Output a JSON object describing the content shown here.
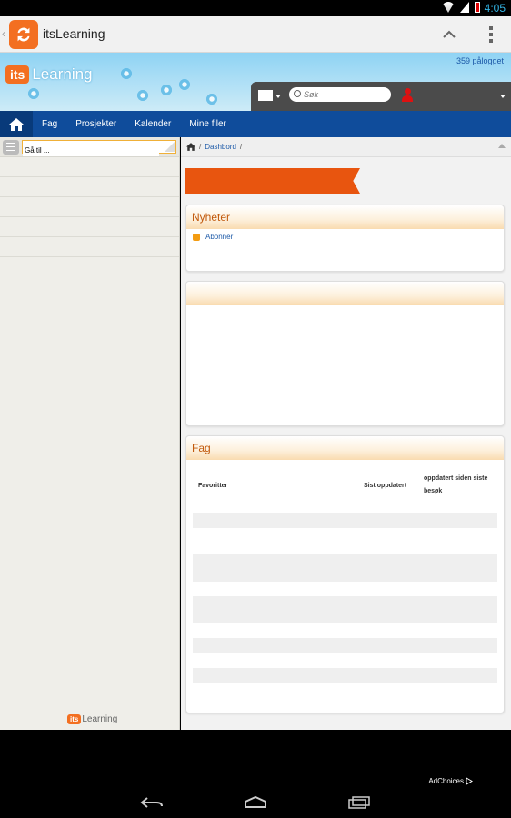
{
  "status_bar": {
    "time": "4:05"
  },
  "action_bar": {
    "title": "itsLearning"
  },
  "banner": {
    "logo_its": "its",
    "logo_learning": "Learning",
    "online_count": "359 pålogget"
  },
  "user_bar": {
    "search_placeholder": "Søk"
  },
  "nav": {
    "items": [
      "Fag",
      "Prosjekter",
      "Kalender",
      "Mine filer"
    ]
  },
  "sidebar": {
    "goto_value": "Gå til ...",
    "footer_its": "its",
    "footer_learning": "Learning"
  },
  "breadcrumb": {
    "items": [
      "Dashbord"
    ]
  },
  "news": {
    "title": "Nyheter",
    "subscribe": "Abonner"
  },
  "fag": {
    "title": "Fag",
    "columns": [
      "Favoritter",
      "Sist oppdatert",
      "oppdatert siden siste besøk"
    ]
  },
  "footer": {
    "adchoices": "AdChoices"
  },
  "colors": {
    "accent": "#f36f21",
    "nav": "#0f4c9b",
    "ribbon": "#e8550f",
    "heading": "#c25a0d"
  }
}
